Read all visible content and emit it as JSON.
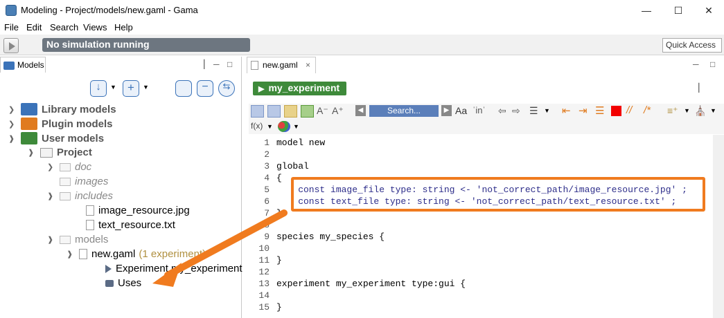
{
  "window": {
    "title": "Modeling - Project/models/new.gaml - Gama"
  },
  "menu": [
    "File",
    "Edit",
    "Search",
    "Views",
    "Help"
  ],
  "toolbar": {
    "status": "No simulation running",
    "quick_access": "Quick Access"
  },
  "left_panel": {
    "tab_label": "Models",
    "tree": [
      {
        "label": "Library models",
        "style": "bold"
      },
      {
        "label": "Plugin models",
        "style": "bold"
      },
      {
        "label": "User models",
        "style": "bold"
      },
      {
        "label": "Project",
        "style": "bold"
      },
      {
        "label": "doc",
        "style": "gray"
      },
      {
        "label": "images",
        "style": "gray"
      },
      {
        "label": "includes",
        "style": "gray"
      },
      {
        "label": "image_resource.jpg",
        "style": "normal"
      },
      {
        "label": "text_resource.txt",
        "style": "normal"
      },
      {
        "label": "models",
        "style": "gray"
      },
      {
        "label": "new.gaml",
        "style": "normal",
        "suffix": "(1 experiment)"
      },
      {
        "label": "Experiment my_experiment",
        "style": "normal"
      },
      {
        "label": "Uses",
        "style": "normal"
      }
    ]
  },
  "editor": {
    "tab_label": "new.gaml",
    "experiment_button": "my_experiment",
    "search_placeholder": "Search...",
    "lines": [
      {
        "n": "1",
        "text": "model new"
      },
      {
        "n": "2",
        "text": ""
      },
      {
        "n": "3",
        "text": "global"
      },
      {
        "n": "4",
        "text": "{"
      },
      {
        "n": "5",
        "text": "    const image_file type: string <- 'not_correct_path/image_resource.jpg' ;"
      },
      {
        "n": "6",
        "text": "    const text_file type: string <- 'not_correct_path/text_resource.txt' ;"
      },
      {
        "n": "7",
        "text": "}"
      },
      {
        "n": "8",
        "text": ""
      },
      {
        "n": "9",
        "text": "species my_species {"
      },
      {
        "n": "10",
        "text": ""
      },
      {
        "n": "11",
        "text": "}"
      },
      {
        "n": "12",
        "text": ""
      },
      {
        "n": "13",
        "text": "experiment my_experiment type:gui {"
      },
      {
        "n": "14",
        "text": ""
      },
      {
        "n": "15",
        "text": "}"
      }
    ]
  },
  "colors": {
    "accent_orange": "#f07b1f",
    "experiment_green": "#3e8a3a",
    "status_gray": "#6d7680"
  }
}
